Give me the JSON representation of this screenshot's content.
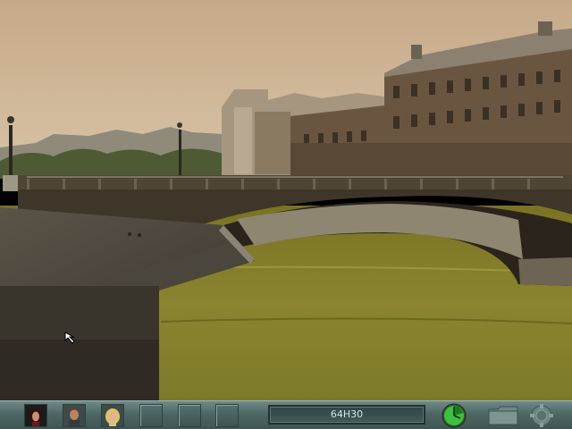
{
  "hud": {
    "time_display": "64H30",
    "accent_color": "#3fbf3f",
    "characters": [
      "character-portrait-woman-dark-hair",
      "character-portrait-man",
      "character-portrait-woman-blonde"
    ],
    "inventory_slots": 3,
    "icons": [
      "clock-icon",
      "folder-icon",
      "gear-icon",
      "arrow-cursor-icon"
    ]
  },
  "scene": {
    "description_icon": "paris-seine-bridge-view"
  }
}
